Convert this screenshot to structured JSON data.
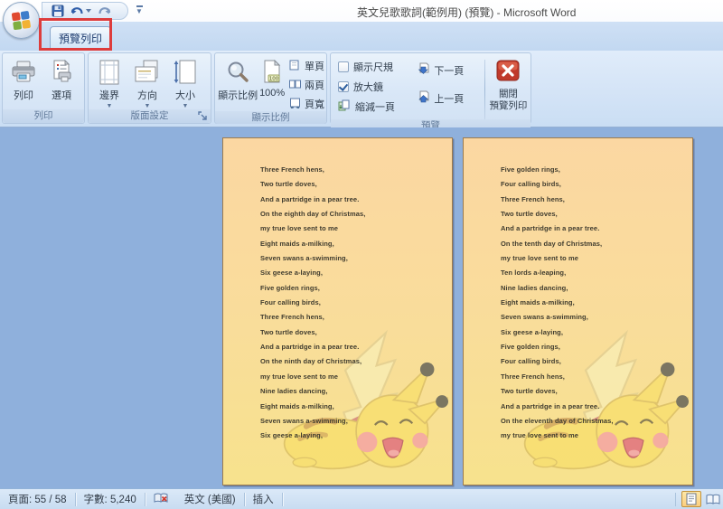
{
  "window": {
    "title": "英文兒歌歌詞(範例用) (預覽) - Microsoft Word"
  },
  "tab": {
    "label": "預覽列印"
  },
  "ribbon": {
    "print": {
      "group_label": "列印",
      "print": "列印",
      "options": "選項"
    },
    "page_setup": {
      "group_label": "版面設定",
      "margins": "邊界",
      "orientation": "方向",
      "size": "大小"
    },
    "zoom": {
      "group_label": "顯示比例",
      "zoom": "顯示比例",
      "hundred": "100%",
      "one_page": "單頁",
      "two_pages": "兩頁",
      "page_width": "頁寬"
    },
    "preview": {
      "group_label": "預覽",
      "show_ruler": "顯示尺規",
      "magnifier": "放大鏡",
      "shrink_one_page": "縮減一頁",
      "next_page": "下一頁",
      "prev_page": "上一頁",
      "close_line1": "關閉",
      "close_line2": "預覽列印",
      "show_ruler_checked": false,
      "magnifier_checked": true
    }
  },
  "document": {
    "pages": [
      {
        "lines": [
          "Three French hens,",
          "Two turtle doves,",
          "And a partridge in a pear tree.",
          "On the eighth day of Christmas,",
          "my true love sent to me",
          "Eight maids a-milking,",
          "Seven swans a-swimming,",
          "Six geese a-laying,",
          "Five golden rings,",
          "Four calling birds,",
          "Three French hens,",
          "Two turtle doves,",
          "And a partridge in a pear tree.",
          "On the ninth day of Christmas,",
          "my true love sent to me",
          "Nine ladies dancing,",
          "Eight maids a-milking,",
          "Seven swans a-swimming,",
          "Six geese a-laying,"
        ]
      },
      {
        "lines": [
          "Five golden rings,",
          "Four calling birds,",
          "Three French hens,",
          "Two turtle doves,",
          "And a partridge in a pear tree.",
          "On the tenth day of Christmas,",
          "my true love sent to me",
          "Ten lords a-leaping,",
          "Nine ladies dancing,",
          "Eight maids a-milking,",
          "Seven swans a-swimming,",
          "Six geese a-laying,",
          "Five golden rings,",
          "Four calling birds,",
          "Three French hens,",
          "Two turtle doves,",
          "And a partridge in a pear tree.",
          "On the eleventh day of Christmas,",
          "my true love sent to me"
        ]
      }
    ]
  },
  "status_bar": {
    "page": "頁面: 55 / 58",
    "words": "字數: 5,240",
    "language": "英文 (美國)",
    "insert_mode": "插入"
  },
  "colors": {
    "annotation_red": "#dd3c3c",
    "canvas_blue": "#8fb0dc",
    "page_top": "#fbd7a2",
    "page_bottom": "#f7e28d",
    "close_button_red": "#c0392b"
  }
}
